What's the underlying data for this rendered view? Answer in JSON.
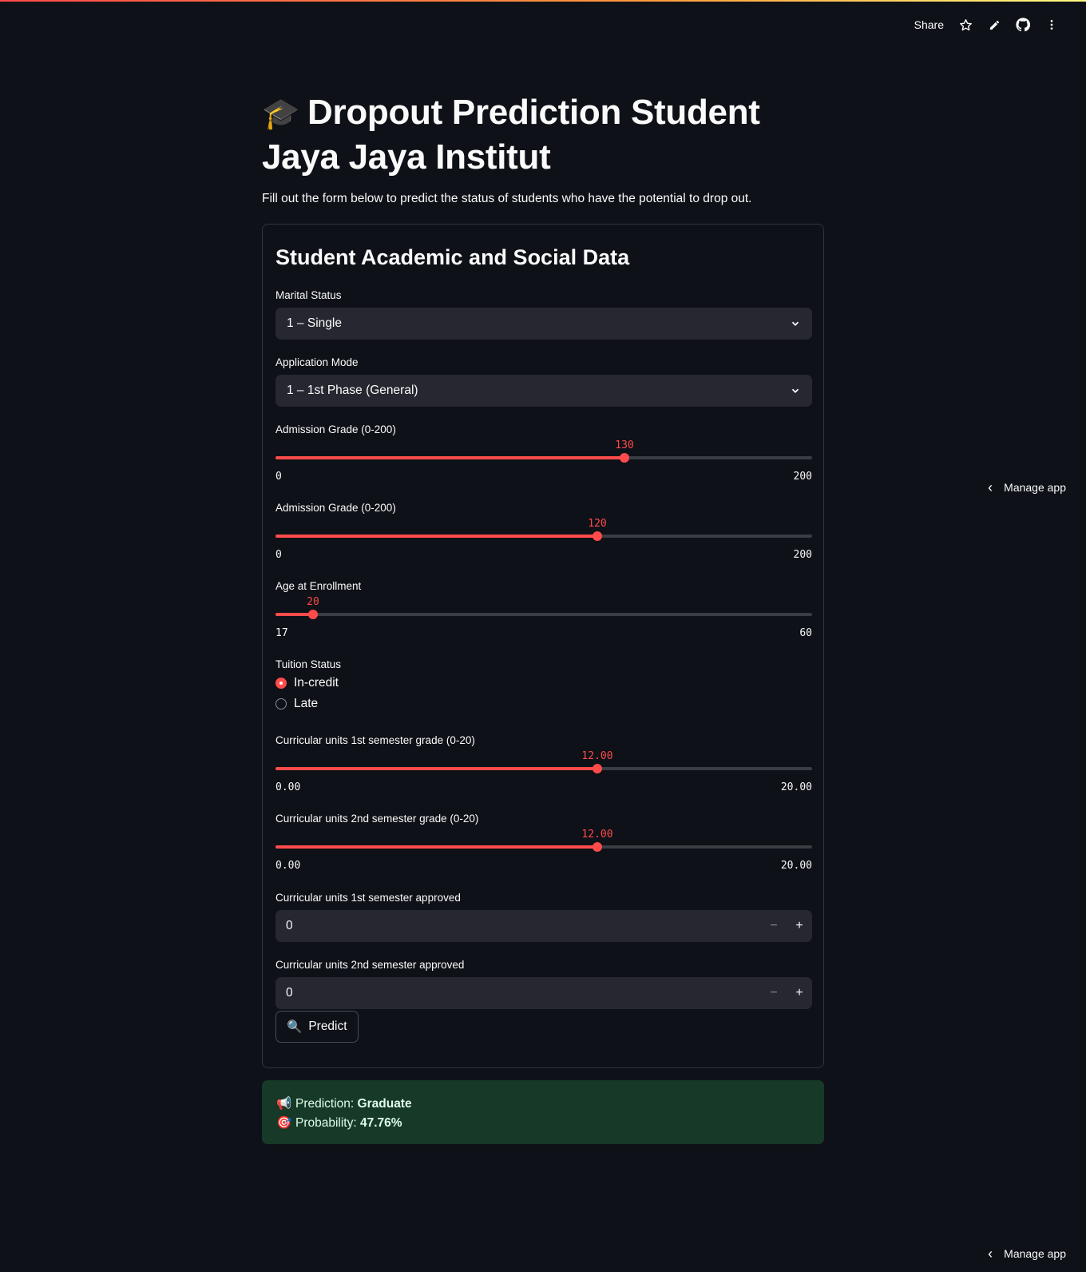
{
  "header": {
    "share_label": "Share",
    "icons": [
      "star-icon",
      "pencil-icon",
      "github-icon",
      "more-vertical-icon"
    ]
  },
  "manage_app_label": "Manage app",
  "page": {
    "title_emoji": "🎓",
    "title": "Dropout Prediction Student Jaya Jaya Institut",
    "subtitle": "Fill out the form below to predict the status of students who have the potential to drop out."
  },
  "form": {
    "title": "Student Academic and Social Data",
    "marital_status": {
      "label": "Marital Status",
      "value": "1 – Single"
    },
    "application_mode": {
      "label": "Application Mode",
      "value": "1 – 1st Phase (General)"
    },
    "sliders": [
      {
        "label": "Admission Grade (0-200)",
        "value": 130,
        "display": "130",
        "min": 0,
        "max": 200,
        "min_label": "0",
        "max_label": "200"
      },
      {
        "label": "Admission Grade (0-200)",
        "value": 120,
        "display": "120",
        "min": 0,
        "max": 200,
        "min_label": "0",
        "max_label": "200"
      },
      {
        "label": "Age at Enrollment",
        "value": 20,
        "display": "20",
        "min": 17,
        "max": 60,
        "min_label": "17",
        "max_label": "60"
      }
    ],
    "tuition_status": {
      "label": "Tuition Status",
      "options": [
        "In-credit",
        "Late"
      ],
      "selected": "In-credit"
    },
    "grade_sliders": [
      {
        "label": "Curricular units 1st semester grade (0-20)",
        "value": 12,
        "display": "12.00",
        "min": 0,
        "max": 20,
        "min_label": "0.00",
        "max_label": "20.00"
      },
      {
        "label": "Curricular units 2nd semester grade (0-20)",
        "value": 12,
        "display": "12.00",
        "min": 0,
        "max": 20,
        "min_label": "0.00",
        "max_label": "20.00"
      }
    ],
    "approved_1st": {
      "label": "Curricular units 1st semester approved",
      "value": "0"
    },
    "approved_2nd": {
      "label": "Curricular units 2nd semester approved",
      "value": "0"
    },
    "stepper": {
      "minus": "−",
      "plus": "+"
    },
    "predict_button": {
      "icon": "🔍",
      "label": "Predict"
    }
  },
  "result": {
    "prediction_icon": "📢",
    "prediction_label": "Prediction:",
    "prediction_value": "Graduate",
    "probability_icon": "🎯",
    "probability_label": "Probability:",
    "probability_value": "47.76%"
  },
  "colors": {
    "background": "#0e1117",
    "accent": "#ff4b4b",
    "input_bg": "#262730",
    "success_bg": "#173928"
  }
}
